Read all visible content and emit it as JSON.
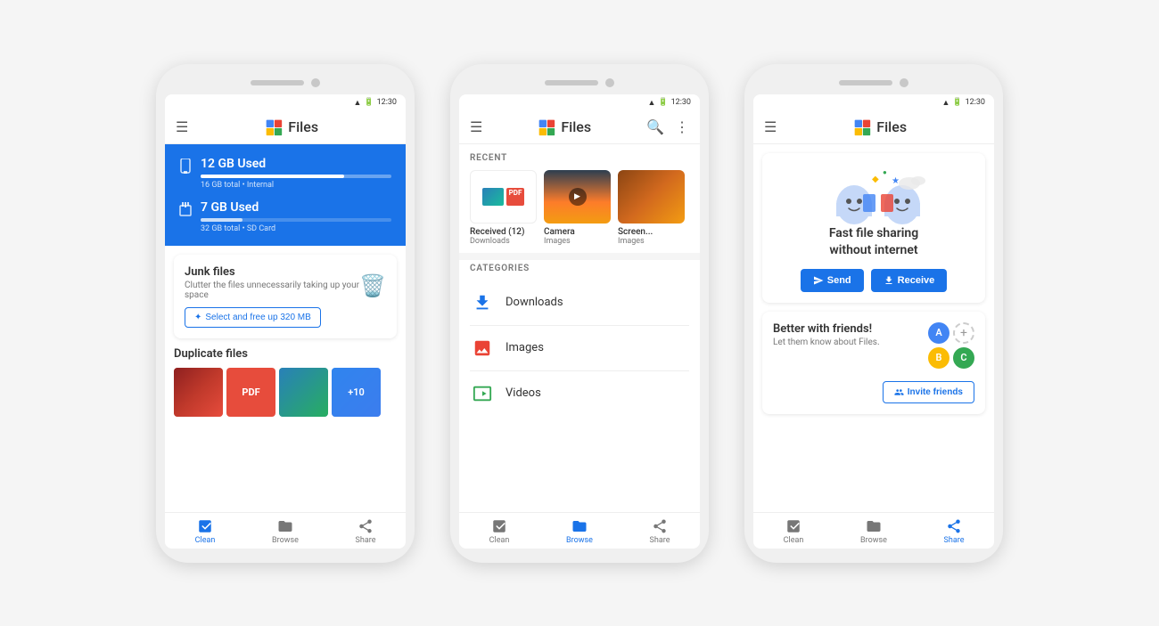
{
  "phones": [
    {
      "id": "phone1",
      "status_time": "12:30",
      "app_title": "Files",
      "storage": [
        {
          "icon": "📱",
          "title": "12 GB Used",
          "fill_percent": 75,
          "subtitle": "16 GB total • Internal"
        },
        {
          "icon": "💾",
          "title": "7 GB Used",
          "fill_percent": 22,
          "subtitle": "32 GB total • SD Card"
        }
      ],
      "junk": {
        "title": "Junk files",
        "desc": "Clutter the files unnecessarily taking up your space",
        "btn_label": "Select and free up 320 MB"
      },
      "duplicate": {
        "title": "Duplicate files",
        "count_overlay": "+10"
      },
      "nav": [
        {
          "label": "Clean",
          "active": true
        },
        {
          "label": "Browse",
          "active": false
        },
        {
          "label": "Share",
          "active": false
        }
      ]
    },
    {
      "id": "phone2",
      "status_time": "12:30",
      "app_title": "Files",
      "recent_label": "RECENT",
      "recent_items": [
        {
          "title": "Received (12)",
          "sub": "Downloads",
          "type": "received"
        },
        {
          "title": "Camera",
          "sub": "Images",
          "type": "sky"
        },
        {
          "title": "Screen...",
          "sub": "Images",
          "type": "food"
        }
      ],
      "categories_label": "CATEGORIES",
      "categories": [
        {
          "label": "Downloads",
          "icon": "⬇"
        },
        {
          "label": "Images",
          "icon": "🖼"
        },
        {
          "label": "Videos",
          "icon": "📅"
        }
      ],
      "nav": [
        {
          "label": "Clean",
          "active": false
        },
        {
          "label": "Browse",
          "active": true
        },
        {
          "label": "Share",
          "active": false
        }
      ]
    },
    {
      "id": "phone3",
      "status_time": "12:30",
      "app_title": "Files",
      "sharing": {
        "title": "Fast file sharing\nwithout internet",
        "send_label": "Send",
        "receive_label": "Receive"
      },
      "friends": {
        "title": "Better with friends!",
        "desc": "Let them know about Files.",
        "invite_label": "Invite friends"
      },
      "nav": [
        {
          "label": "Clean",
          "active": false
        },
        {
          "label": "Browse",
          "active": false
        },
        {
          "label": "Share",
          "active": true
        }
      ]
    }
  ]
}
